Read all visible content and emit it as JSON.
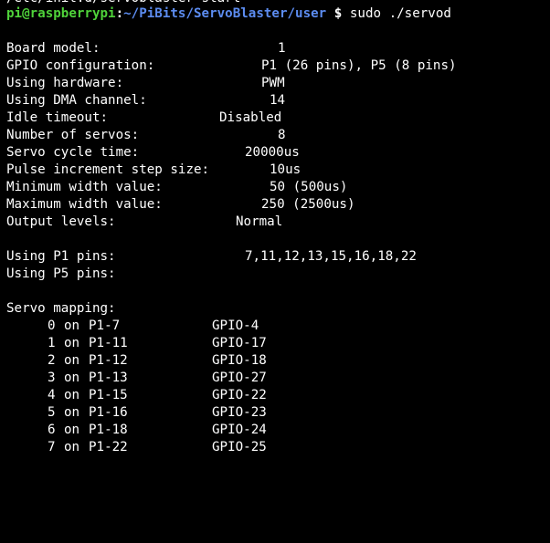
{
  "terminal": {
    "previous_command": "/etc/init.d/servoblaster start",
    "prompt": {
      "user_host": "pi@raspberrypi",
      "separator": ":",
      "path": "~/PiBits/ServoBlaster/user",
      "symbol": "$",
      "command": "sudo ./servod"
    },
    "config": [
      {
        "label": "Board model:",
        "value": "1"
      },
      {
        "label": "GPIO configuration:",
        "value": "P1 (26 pins), P5 (8 pins)"
      },
      {
        "label": "Using hardware:",
        "value": "PWM"
      },
      {
        "label": "Using DMA channel:",
        "value": "14"
      },
      {
        "label": "Idle timeout:",
        "value": "Disabled"
      },
      {
        "label": "Number of servos:",
        "value": "8"
      },
      {
        "label": "Servo cycle time:",
        "value": "20000us"
      },
      {
        "label": "Pulse increment step size:",
        "value": "10us"
      },
      {
        "label": "Minimum width value:",
        "value": "50 (500us)"
      },
      {
        "label": "Maximum width value:",
        "value": "250 (2500us)"
      },
      {
        "label": "Output levels:",
        "value": "Normal"
      }
    ],
    "pins": [
      {
        "label": "Using P1 pins:",
        "value": "7,11,12,13,15,16,18,22"
      },
      {
        "label": "Using P5 pins:",
        "value": ""
      }
    ],
    "mapping_title": "Servo mapping:",
    "mapping": [
      {
        "servo": "0",
        "on": "on",
        "pin": "P1-7",
        "gpio": "GPIO-4"
      },
      {
        "servo": "1",
        "on": "on",
        "pin": "P1-11",
        "gpio": "GPIO-17"
      },
      {
        "servo": "2",
        "on": "on",
        "pin": "P1-12",
        "gpio": "GPIO-18"
      },
      {
        "servo": "3",
        "on": "on",
        "pin": "P1-13",
        "gpio": "GPIO-27"
      },
      {
        "servo": "4",
        "on": "on",
        "pin": "P1-15",
        "gpio": "GPIO-22"
      },
      {
        "servo": "5",
        "on": "on",
        "pin": "P1-16",
        "gpio": "GPIO-23"
      },
      {
        "servo": "6",
        "on": "on",
        "pin": "P1-18",
        "gpio": "GPIO-24"
      },
      {
        "servo": "7",
        "on": "on",
        "pin": "P1-22",
        "gpio": "GPIO-25"
      }
    ],
    "colors": {
      "background": "#000000",
      "text": "#ffffff",
      "prompt_user": "#4fd23a",
      "prompt_path": "#5c8cf0"
    }
  }
}
